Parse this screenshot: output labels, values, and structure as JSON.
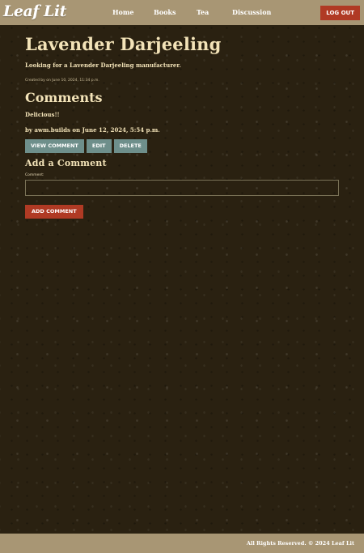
{
  "navbar": {
    "logo": "Leaf Lit",
    "links": [
      "Home",
      "Books",
      "Tea",
      "Discussion"
    ],
    "logout_label": "LOG OUT"
  },
  "post": {
    "title": "Lavender Darjeeling",
    "subtitle": "Looking for a Lavender Darjeeling manufacturer.",
    "meta": "Created by on June 10, 2024, 11:34 p.m."
  },
  "comments": {
    "heading": "Comments",
    "items": [
      {
        "body": "Delicious!!",
        "author_line": "by awm.builds on June 12, 2024, 5:54 p.m.",
        "actions": [
          "VIEW COMMENT",
          "EDIT",
          "DELETE"
        ]
      }
    ]
  },
  "add_comment": {
    "heading": "Add a Comment",
    "field_label": "Comment:",
    "input_value": "",
    "button_label": "ADD COMMENT"
  },
  "footer": {
    "text": "All Rights Reserved. © 2024 Leaf Lit"
  },
  "colors": {
    "navbar": "#a89674",
    "background": "#2a2111",
    "accent_red": "#b03a24",
    "button_teal": "#6e8f8b",
    "text_cream": "#f3e3b8"
  }
}
